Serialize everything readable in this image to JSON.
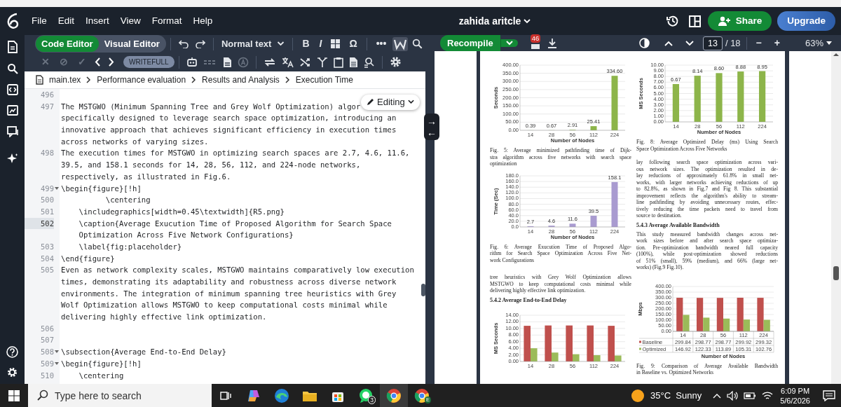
{
  "header": {
    "menu": [
      "File",
      "Edit",
      "Insert",
      "View",
      "Format",
      "Help"
    ],
    "project_title": "zahida aritcle",
    "buttons": [
      {
        "kind": "share",
        "label": "Share"
      },
      {
        "kind": "upgrade",
        "label": "Upgrade"
      }
    ]
  },
  "editor": {
    "modes": [
      {
        "label": "Code Editor",
        "selected": true
      },
      {
        "label": "Visual Editor",
        "selected": false
      }
    ],
    "text_style": "Normal text",
    "format_buttons": [
      "B",
      "I",
      "Ω"
    ],
    "more": "•••",
    "review_buttons": [
      {
        "glyph": "✕",
        "disabled": true
      },
      {
        "glyph": "⊘",
        "disabled": true
      },
      {
        "glyph": "✓",
        "disabled": true
      }
    ],
    "writefull": "WRITEFULL",
    "breadcrumb": [
      "main.tex",
      "Performance evaluation",
      "Results and Analysis",
      "Execution Time"
    ],
    "status_badge": "Editing",
    "code_lines": [
      {
        "number": "496"
      },
      {
        "number": "497",
        "rows": [
          "The MSTGWO (Minimum Spanning Tree and Grey Wolf Optimization) algor",
          "specifically designed to leverage search space optimization, introducing an",
          "innovative approach that achieves significant efficiency in execution times",
          "across networks of varying sizes."
        ]
      },
      {
        "number": "498",
        "rows": [
          "The execution times for MSTGWO in optimizing search spaces are 2.7, 4.6, 11.6,",
          "39.5, and 158.1 seconds for 14, 28, 56, 112, and 224-node networks,",
          "respectively, as illustrated in Fig.6."
        ]
      },
      {
        "number": "499",
        "foldable": true,
        "rows": [
          "\\begin{figure}[!h]"
        ]
      },
      {
        "number": "500",
        "rows": [
          "          \\centering"
        ]
      },
      {
        "number": "501",
        "rows": [
          "    \\includegraphics[width=0.45\\textwidth]{R5.png}"
        ]
      },
      {
        "number": "502",
        "current": true,
        "rows": [
          "    \\caption{Average Exucution Time of Proposed Algorithm for Search Space",
          "    Optimization Across Five Network Configurations}"
        ]
      },
      {
        "number": "503",
        "rows": [
          "    \\label{fig:placeholder}"
        ]
      },
      {
        "number": "504",
        "rows": [
          "\\end{figure}"
        ]
      },
      {
        "number": "505",
        "rows": [
          "Even as network complexity scales, MSTGWO maintains comparatively low execution",
          "times, demonstrating its adaptability and robustness across diverse network",
          "environments. The integration of minimum spanning tree heuristics with Grey",
          "Wolf Optimization allows MSTGWO to keep computational costs minimal while",
          "delivering highly effective link optimization."
        ]
      },
      {
        "number": "506"
      },
      {
        "number": "507"
      },
      {
        "number": "508",
        "foldable": true,
        "rows": [
          "\\subsection{Average End-to-End Delay}"
        ]
      },
      {
        "number": "509",
        "foldable": true,
        "rows": [
          "\\begin{figure}[!h]"
        ]
      },
      {
        "number": "510",
        "rows": [
          "    \\centering"
        ]
      }
    ]
  },
  "divider": {
    "arrows": [
      "→",
      "←"
    ]
  },
  "pdf": {
    "recompile": "Recompile",
    "log_count": "46",
    "page": "13",
    "page_total": "/ 18",
    "zoom_out": "−",
    "zoom_in": "+",
    "zoom": "63%",
    "left_column": [
      {
        "kind": "figure",
        "chart_data": {
          "type": "bar",
          "xlabel": "Number of Nodes",
          "ylabel": "Seconds",
          "categories": [
            "14",
            "28",
            "56",
            "112",
            "224"
          ],
          "series": [
            {
              "color": "#8db54a",
              "values": [
                0.39,
                0.67,
                2.91,
                25.41,
                334.6
              ],
              "value_labels": [
                "0.39",
                "0.67",
                "2.91",
                "25.41",
                "334.60"
              ]
            }
          ],
          "ylim": [
            0,
            400
          ],
          "yticks": [
            {
              "value": 0,
              "label": "0.00"
            },
            {
              "value": 50,
              "label": "50.00"
            },
            {
              "value": 100,
              "label": "100.00"
            },
            {
              "value": 150,
              "label": "150.00"
            },
            {
              "value": 200,
              "label": "200.00"
            },
            {
              "value": 250,
              "label": "250.00"
            },
            {
              "value": 300,
              "label": "300.00"
            },
            {
              "value": 350,
              "label": "350.00"
            },
            {
              "value": 400,
              "label": "400.00"
            }
          ],
          "grid": true,
          "data_labels": true
        }
      },
      {
        "kind": "caption",
        "lines": [
          "Fig. 5: Average minimized pathfinding time of Dijk-",
          "stra algorithm across five networks with search space",
          "optimization"
        ]
      },
      {
        "kind": "figure",
        "chart_data": {
          "type": "bar",
          "xlabel": "Number of Nodes",
          "ylabel": "Time (Sec)",
          "categories": [
            "14",
            "28",
            "56",
            "112",
            "224"
          ],
          "series": [
            {
              "color": "#a99bd0",
              "values": [
                2.7,
                4.6,
                11.6,
                39.5,
                158.1
              ],
              "value_labels": [
                "2.7",
                "4.6",
                "11.6",
                "39.5",
                "158.1"
              ]
            }
          ],
          "ylim": [
            0,
            180
          ],
          "yticks": [
            {
              "value": 0,
              "label": "0.0"
            },
            {
              "value": 20,
              "label": "20.0"
            },
            {
              "value": 40,
              "label": "40.0"
            },
            {
              "value": 60,
              "label": "60.0"
            },
            {
              "value": 80,
              "label": "80.0"
            },
            {
              "value": 100,
              "label": "100.0"
            },
            {
              "value": 120,
              "label": "120.0"
            },
            {
              "value": 140,
              "label": "140.0"
            },
            {
              "value": 160,
              "label": "160.0"
            },
            {
              "value": 180,
              "label": "180.0"
            }
          ],
          "grid": true,
          "data_labels": true
        }
      },
      {
        "kind": "caption",
        "lines": [
          "Fig. 6: Average Exucution Time of Proposed Algo-",
          "rithm for Search Space Optimization Across Five Net-",
          "work Configurations"
        ]
      },
      {
        "kind": "paragraph",
        "lines": [
          "tree heuristics with Grey Wolf Optimization allows",
          "MSTGWO to keep computational costs minimal while",
          "delivering highly effective link optimization."
        ]
      },
      {
        "kind": "heading",
        "text": "5.4.2 Average End-to-End Delay"
      },
      {
        "kind": "figure",
        "chart_data": {
          "type": "bar",
          "ylabel": "MS Seconds",
          "categories": [
            "14",
            "28",
            "56",
            "112",
            "224"
          ],
          "series": [
            {
              "color": "#c0504d",
              "values": [
                10.8,
                10.9,
                10.9,
                10.9,
                10.8
              ]
            },
            {
              "color": "#9bbb59",
              "values": [
                4.0,
                2.7,
                2.2,
                1.9,
                1.8
              ]
            }
          ],
          "ylim": [
            0,
            14
          ],
          "yticks": [
            {
              "value": 0,
              "label": "0.00"
            },
            {
              "value": 2,
              "label": "2.00"
            },
            {
              "value": 4,
              "label": "4.00"
            },
            {
              "value": 6,
              "label": "6.00"
            },
            {
              "value": 8,
              "label": "8.00"
            },
            {
              "value": 10,
              "label": "10.00"
            },
            {
              "value": 12,
              "label": "12.00"
            },
            {
              "value": 14,
              "label": "14.00"
            }
          ],
          "grid": true
        }
      }
    ],
    "right_column": [
      {
        "kind": "figure",
        "chart_data": {
          "type": "bar",
          "xlabel": "Number of Nodes",
          "ylabel": "MS Seconds",
          "categories": [
            "14",
            "28",
            "56",
            "112",
            "224"
          ],
          "series": [
            {
              "color": "#8db54a",
              "values": [
                6.67,
                8.14,
                8.6,
                8.88,
                8.95
              ],
              "value_labels": [
                "6.67",
                "8.14",
                "8.60",
                "8.88",
                "8.95"
              ]
            }
          ],
          "ylim": [
            0,
            10
          ],
          "yticks": [
            {
              "value": 0,
              "label": "0.00"
            },
            {
              "value": 1,
              "label": "1.00"
            },
            {
              "value": 2,
              "label": "2.00"
            },
            {
              "value": 3,
              "label": "3.00"
            },
            {
              "value": 4,
              "label": "4.00"
            },
            {
              "value": 5,
              "label": "5.00"
            },
            {
              "value": 6,
              "label": "6.00"
            },
            {
              "value": 7,
              "label": "7.00"
            },
            {
              "value": 8,
              "label": "8.00"
            },
            {
              "value": 9,
              "label": "9.00"
            },
            {
              "value": 10,
              "label": "10.00"
            }
          ],
          "grid": true,
          "data_labels": true
        }
      },
      {
        "kind": "caption",
        "lines": [
          "Fig. 8: Average Optimized Delay (ms) Using Search",
          "Space Optimization Across Five Networks"
        ]
      },
      {
        "kind": "paragraph",
        "lines": [
          "lay following search space optimization across vari-",
          "ous network sizes.  The optimization resulted in de-",
          "lay reductions of approximately 61.8% in small net-",
          "works, with larger networks achieving reductions of up",
          "to 82.8%, as shown in Fig.7 and Fig 8. This substantial",
          "improvement reflects the algorithm's ability to stream-",
          "line pathfinding by avoiding unnecessary routes, effec-",
          "tively reducing the time packets need to travel from",
          "source to destination."
        ]
      },
      {
        "kind": "heading",
        "text": "5.4.3 Average Available Bandwidth"
      },
      {
        "kind": "paragraph",
        "lines": [
          "This study measured bandwidth changes across net-",
          "work sizes before and after search space optimiza-",
          "tion. Pre-optimization bandwidth neared full capacity",
          "(100%), while post-optimization showed reductions",
          "of 51% (small), 59% (medium), and 66% (large net-",
          "works) (Fig.9 Fig.10)."
        ]
      },
      {
        "kind": "figure",
        "chart_data": {
          "type": "bar",
          "xlabel": "Number of Nodes",
          "ylabel": "Mbps",
          "categories": [
            "14",
            "28",
            "56",
            "112",
            "224"
          ],
          "series": [
            {
              "name": "Baseline",
              "color": "#c0504d",
              "values": [
                299.84,
                298.77,
                298.77,
                299.92,
                299.32
              ],
              "value_labels": [
                "299.84",
                "298.77",
                "298.77",
                "299.92",
                "299.32"
              ]
            },
            {
              "name": "Optimized",
              "color": "#9bbb59",
              "values": [
                146.92,
                122.33,
                113.89,
                105.31,
                102.76
              ],
              "value_labels": [
                "146.92",
                "122.33",
                "113.89",
                "105.31",
                "102.76"
              ]
            }
          ],
          "ylim": [
            0,
            400
          ],
          "yticks": [
            {
              "value": 0,
              "label": "0.00"
            },
            {
              "value": 50,
              "label": "50.00"
            },
            {
              "value": 100,
              "label": "100.00"
            },
            {
              "value": 150,
              "label": "150.00"
            },
            {
              "value": 200,
              "label": "200.00"
            },
            {
              "value": 250,
              "label": "250.00"
            },
            {
              "value": 300,
              "label": "300.00"
            },
            {
              "value": 350,
              "label": "350.00"
            },
            {
              "value": 400,
              "label": "400.00"
            }
          ],
          "grid": true,
          "legend": true
        }
      },
      {
        "kind": "caption",
        "lines": [
          "Fig. 9: Comparison of Average Available Bandwidth",
          "in Baseline vs. Optimized Networks"
        ]
      }
    ]
  },
  "taskbar": {
    "search_placeholder": "Type here to search",
    "whatsapp_badge": "3",
    "profile_letter": "E",
    "weather": "35°C  Sunny",
    "time": "6:09 PM",
    "date": "5/6/2026"
  }
}
